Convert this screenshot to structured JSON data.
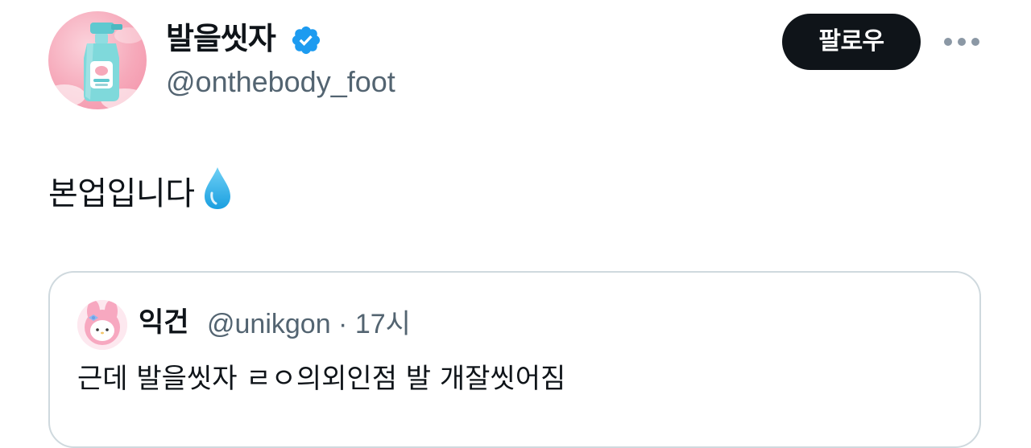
{
  "author": {
    "display_name": "발을씻자",
    "handle": "@onthebody_foot",
    "verified": true,
    "avatar_icon": "foot-spray-bottle-avatar"
  },
  "actions": {
    "follow_label": "팔로우",
    "more_icon": "more-horizontal-icon"
  },
  "tweet": {
    "text": "본업입니다",
    "emoji": "droplet-emoji"
  },
  "quoted": {
    "display_name": "익건",
    "handle_time": "@unikgon · 17시",
    "text": "근데 발을씻자 ㄹㅇ의외인점 발 개잘씻어짐",
    "avatar_icon": "my-melody-avatar"
  },
  "colors": {
    "text_primary": "#0f1419",
    "text_secondary": "#536471",
    "verified_blue": "#1d9bf0",
    "button_bg": "#0f1419",
    "border": "#cfd9de"
  }
}
